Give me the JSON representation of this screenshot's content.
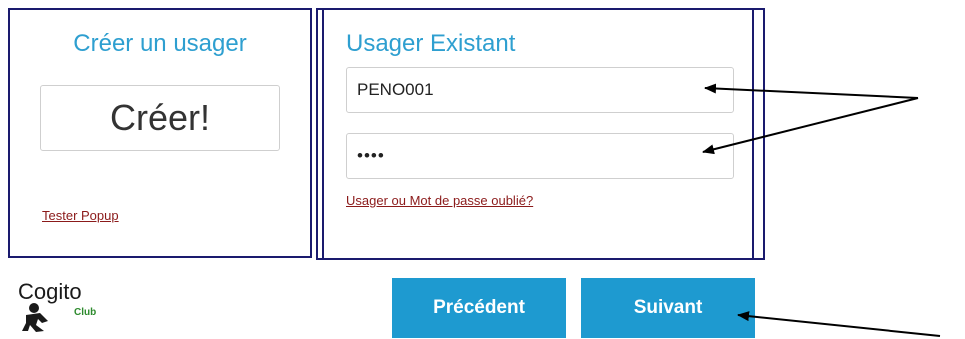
{
  "create_panel": {
    "title": "Créer un usager",
    "create_button": "Créer!",
    "test_popup_link": "Tester Popup"
  },
  "login_panel": {
    "title": "Usager Existant",
    "username_value": "PENO001",
    "password_value": "••••",
    "forgot_link": "Usager ou Mot de passe oublié?"
  },
  "logo": {
    "word": "Cogito",
    "club": "Club"
  },
  "nav": {
    "previous_label": "Précédent",
    "next_label": "Suivant"
  },
  "colors": {
    "accent": "#1e9ad0",
    "title_blue": "#2e9fd0",
    "panel_border": "#1a1a6e",
    "link_red": "#8b1a1a",
    "club_green": "#2e8b2e"
  }
}
